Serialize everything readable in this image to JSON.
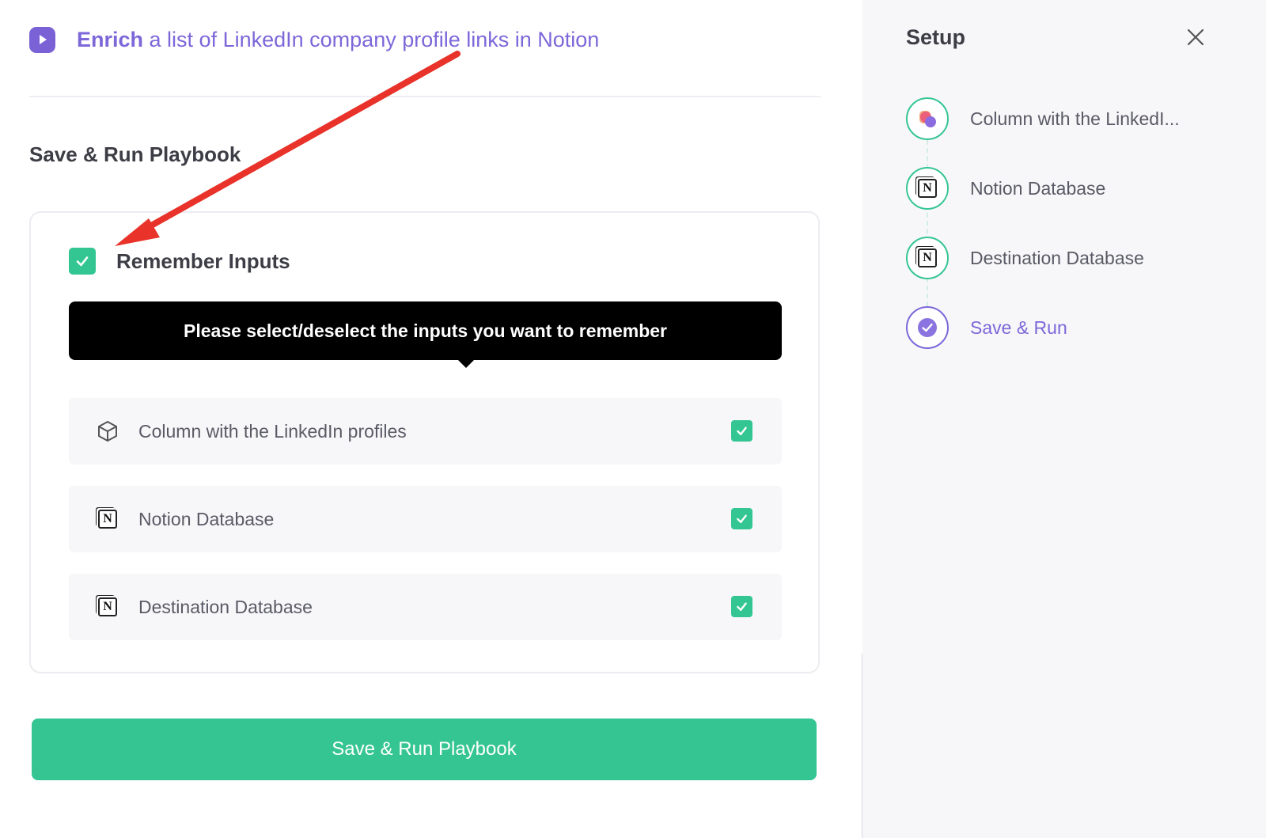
{
  "header": {
    "title_bold": "Enrich",
    "title_rest": " a list of LinkedIn company profile links in Notion"
  },
  "section": {
    "title": "Save & Run Playbook"
  },
  "remember": {
    "label": "Remember Inputs",
    "checked": true
  },
  "tooltip": {
    "text": "Please select/deselect the inputs you want to remember"
  },
  "inputs": [
    {
      "label": "Column with the LinkedIn profiles",
      "icon": "cube-icon",
      "checked": true
    },
    {
      "label": "Notion Database",
      "icon": "notion-icon",
      "checked": true
    },
    {
      "label": "Destination Database",
      "icon": "notion-icon",
      "checked": true
    }
  ],
  "run_button": {
    "label": "Save & Run Playbook"
  },
  "sidebar": {
    "title": "Setup",
    "steps": [
      {
        "label": "Column with the LinkedI...",
        "icon": "app-logo-icon",
        "state": "done"
      },
      {
        "label": "Notion Database",
        "icon": "notion-icon",
        "state": "done"
      },
      {
        "label": "Destination Database",
        "icon": "notion-icon",
        "state": "done"
      },
      {
        "label": "Save & Run",
        "icon": "check-circle-icon",
        "state": "active"
      }
    ]
  },
  "colors": {
    "accent_purple": "#7d67d9",
    "success_green": "#35c593",
    "annotation_red": "#e8322a"
  }
}
